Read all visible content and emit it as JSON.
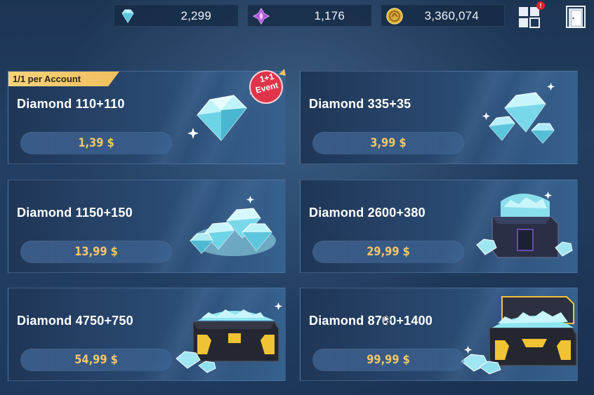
{
  "currencies": [
    {
      "name": "diamond",
      "icon": "diamond-icon",
      "value": "2,299"
    },
    {
      "name": "crystal",
      "icon": "crystal-icon",
      "value": "1,176"
    },
    {
      "name": "gold",
      "icon": "gold-coin-icon",
      "value": "3,360,074"
    }
  ],
  "top_buttons": {
    "menu_icon": "grid-menu-icon",
    "menu_badge": "!",
    "exit_icon": "exit-door-icon"
  },
  "products": [
    {
      "title": "Diamond 110+110",
      "price": "1,39 $",
      "art": "single-diamond",
      "ribbon": "1/1 per Account",
      "event_line1": "1+1",
      "event_line2": "Event"
    },
    {
      "title": "Diamond 335+35",
      "price": "3,99 $",
      "art": "few-diamonds"
    },
    {
      "title": "Diamond 1150+150",
      "price": "13,99 $",
      "art": "diamond-pile"
    },
    {
      "title": "Diamond 2600+380",
      "price": "29,99 $",
      "art": "diamond-crate"
    },
    {
      "title": "Diamond 4750+750",
      "price": "54,99 $",
      "art": "diamond-chest"
    },
    {
      "title": "Diamond 8700+1400",
      "price": "99,99 $",
      "art": "diamond-open-chest"
    }
  ],
  "colors": {
    "price": "#f2c66a",
    "ribbon": "#f0c060",
    "event_badge": "#e0344a",
    "diamond": "#8fe6f2"
  }
}
